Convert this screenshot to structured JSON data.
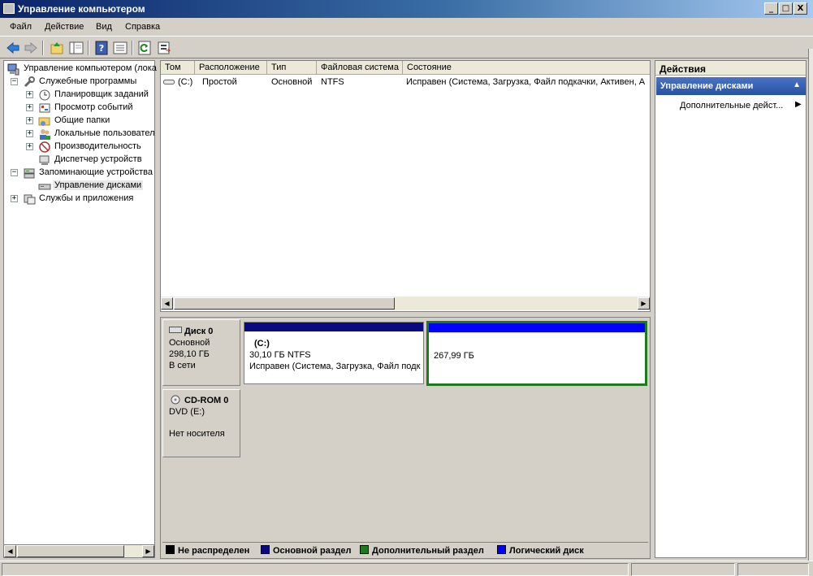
{
  "window": {
    "title": "Управление компьютером",
    "controls": [
      "_",
      "□",
      "X"
    ]
  },
  "menu": [
    "Файл",
    "Действие",
    "Вид",
    "Справка"
  ],
  "toolbar": {
    "buttons": [
      "back-icon",
      "forward-icon",
      "up-folder-icon",
      "show-hide-tree-icon",
      "help-icon",
      "properties-icon",
      "refresh-icon",
      "export-list-icon"
    ]
  },
  "tree": {
    "root": "Управление компьютером (лока",
    "items": [
      {
        "label": "Служебные программы",
        "level": 1,
        "expander": "−"
      },
      {
        "label": "Планировщик заданий",
        "level": 2,
        "expander": "+"
      },
      {
        "label": "Просмотр событий",
        "level": 2,
        "expander": "+"
      },
      {
        "label": "Общие папки",
        "level": 2,
        "expander": "+"
      },
      {
        "label": "Локальные пользовател",
        "level": 2,
        "expander": "+"
      },
      {
        "label": "Производительность",
        "level": 2,
        "expander": "+"
      },
      {
        "label": "Диспетчер устройств",
        "level": 2,
        "expander": ""
      },
      {
        "label": "Запоминающие устройства",
        "level": 1,
        "expander": "−"
      },
      {
        "label": "Управление дисками",
        "level": 2,
        "expander": "",
        "selected": true
      },
      {
        "label": "Службы и приложения",
        "level": 1,
        "expander": "+"
      }
    ]
  },
  "volumes": {
    "columns": [
      "Том",
      "Расположение",
      "Тип",
      "Файловая система",
      "Состояние"
    ],
    "rows": [
      {
        "volume": "(C:)",
        "layout": "Простой",
        "type": "Основной",
        "fs": "NTFS",
        "status": "Исправен (Система, Загрузка, Файл подкачки, Активен, А"
      }
    ]
  },
  "disks": [
    {
      "name": "Диск 0",
      "kind": "Основной",
      "size": "298,10 ГБ",
      "state": "В сети",
      "partitions": [
        {
          "label": "(C:)",
          "size": "30,10 ГБ NTFS",
          "status": "Исправен (Система, Загрузка, Файл подк",
          "bar_color": "#0a0a80"
        },
        {
          "label": "",
          "size": "267,99 ГБ",
          "status": "",
          "bar_color": "#0000ff",
          "frame_color": "#1e7a1e"
        }
      ]
    },
    {
      "name": "CD-ROM 0",
      "kind": "DVD (E:)",
      "state": "Нет носителя"
    }
  ],
  "legend": [
    {
      "label": "Не распределен",
      "color": "#000000"
    },
    {
      "label": "Основной раздел",
      "color": "#0a0a80"
    },
    {
      "label": "Дополнительный раздел",
      "color": "#1e7a1e"
    },
    {
      "label": "Логический диск",
      "color": "#0000ff"
    }
  ],
  "actions": {
    "header": "Действия",
    "section": "Управление дисками",
    "item": "Дополнительные дейст..."
  }
}
